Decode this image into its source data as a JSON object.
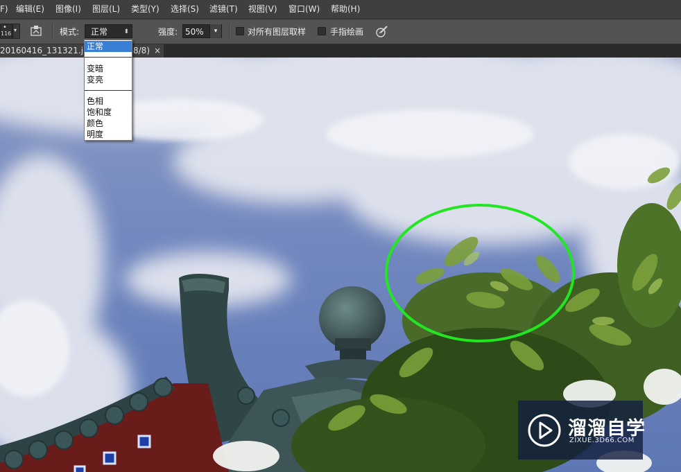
{
  "menubar": {
    "items": [
      "F)",
      "编辑(E)",
      "图像(I)",
      "图层(L)",
      "类型(Y)",
      "选择(S)",
      "滤镜(T)",
      "视图(V)",
      "窗口(W)",
      "帮助(H)"
    ]
  },
  "options": {
    "brush_size": "116",
    "mode_label": "模式:",
    "mode_value": "正常",
    "strength_label": "强度:",
    "strength_value": "50%",
    "sample_all_layers_label": "对所有图层取样",
    "finger_painting_label": "手指绘画"
  },
  "document_tab": {
    "title_left": "20160416_131321.jpg",
    "title_right": "8/8)",
    "close_symbol": "×"
  },
  "mode_dropdown": {
    "group1": [
      "正常"
    ],
    "group2": [
      "变暗",
      "变亮"
    ],
    "group3": [
      "色相",
      "饱和度",
      "颜色",
      "明度"
    ]
  },
  "watermark": {
    "brand": "溜溜自学",
    "url": "ZIXUE.3D66.COM"
  },
  "colors": {
    "highlight_ellipse": "#22e622",
    "dropdown_selection": "#3a7fd6",
    "watermark_bg": "#14203e"
  },
  "icons": [
    "brush-preset-icon",
    "dropdown-arrow-icon",
    "airbrush-toggle-icon",
    "select-updown-icon",
    "pressure-pen-icon",
    "close-icon",
    "play-logo-icon"
  ]
}
